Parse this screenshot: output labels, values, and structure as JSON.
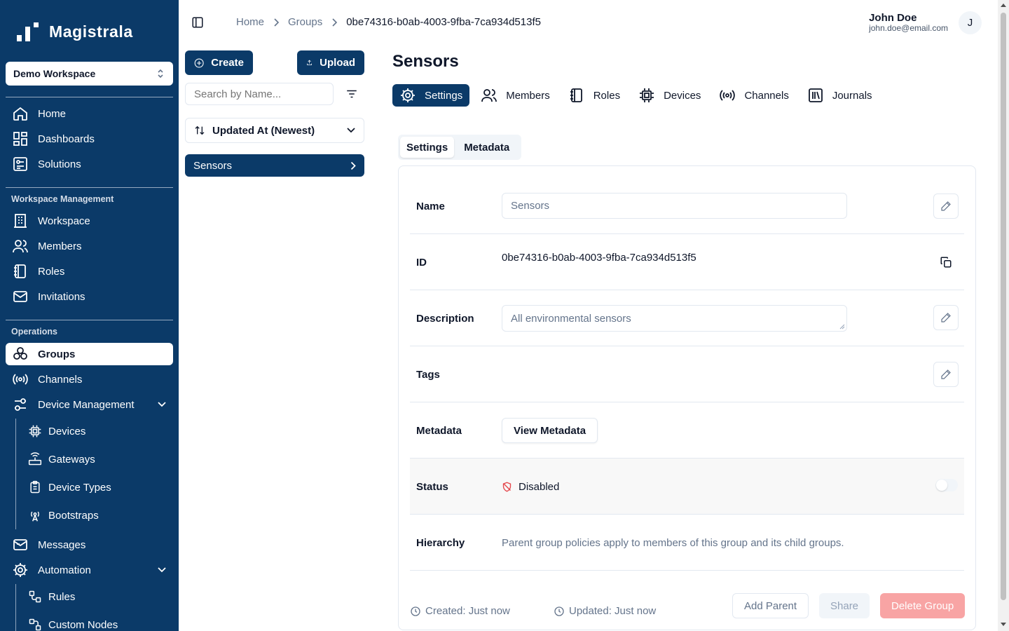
{
  "brand": {
    "name": "Magistrala"
  },
  "workspace": {
    "selected": "Demo Workspace"
  },
  "sidebar": {
    "main": [
      {
        "label": "Home",
        "icon": "home-icon"
      },
      {
        "label": "Dashboards",
        "icon": "dashboard-icon"
      },
      {
        "label": "Solutions",
        "icon": "solutions-icon"
      }
    ],
    "section_management": "Workspace Management",
    "management": [
      {
        "label": "Workspace",
        "icon": "building-icon"
      },
      {
        "label": "Members",
        "icon": "users-icon"
      },
      {
        "label": "Roles",
        "icon": "notebook-icon"
      },
      {
        "label": "Invitations",
        "icon": "mail-icon"
      }
    ],
    "section_operations": "Operations",
    "operations": [
      {
        "label": "Groups",
        "icon": "groups-icon"
      },
      {
        "label": "Channels",
        "icon": "radio-icon"
      },
      {
        "label": "Device Management",
        "icon": "sliders-icon"
      }
    ],
    "device_sub": [
      {
        "label": "Devices",
        "icon": "chip-icon"
      },
      {
        "label": "Gateways",
        "icon": "router-icon"
      },
      {
        "label": "Device Types",
        "icon": "clipboard-icon"
      },
      {
        "label": "Bootstraps",
        "icon": "antenna-icon"
      }
    ],
    "more": [
      {
        "label": "Messages",
        "icon": "mail-open-icon"
      },
      {
        "label": "Automation",
        "icon": "cog-icon"
      }
    ],
    "automation_sub": [
      {
        "label": "Rules",
        "icon": "workflow-icon"
      },
      {
        "label": "Custom Nodes",
        "icon": "nodes-icon"
      }
    ]
  },
  "breadcrumb": [
    "Home",
    "Groups",
    "0be74316-b0ab-4003-9fba-7ca934d513f5"
  ],
  "user": {
    "name": "John Doe",
    "email": "john.doe@email.com",
    "initial": "J"
  },
  "list": {
    "create_label": "Create",
    "upload_label": "Upload",
    "search_placeholder": "Search by Name...",
    "sort_label": "Updated At (Newest)",
    "items": [
      "Sensors"
    ]
  },
  "detail": {
    "title": "Sensors",
    "tabs": [
      "Settings",
      "Members",
      "Roles",
      "Devices",
      "Channels",
      "Journals"
    ],
    "subtabs": [
      "Settings",
      "Metadata"
    ],
    "fields": {
      "name_label": "Name",
      "name_value": "Sensors",
      "id_label": "ID",
      "id_value": "0be74316-b0ab-4003-9fba-7ca934d513f5",
      "description_label": "Description",
      "description_value": "All environmental sensors",
      "tags_label": "Tags",
      "metadata_label": "Metadata",
      "metadata_button": "View Metadata",
      "status_label": "Status",
      "status_value": "Disabled",
      "hierarchy_label": "Hierarchy",
      "hierarchy_text": "Parent group policies apply to members of this group and its child groups."
    },
    "footer": {
      "created": "Created: Just now",
      "updated": "Updated: Just now",
      "add_parent": "Add Parent",
      "share": "Share",
      "delete": "Delete Group"
    }
  },
  "colors": {
    "primary": "#0b3a68",
    "danger_light": "#f8a4a4",
    "status_disabled": "#e5484d"
  }
}
